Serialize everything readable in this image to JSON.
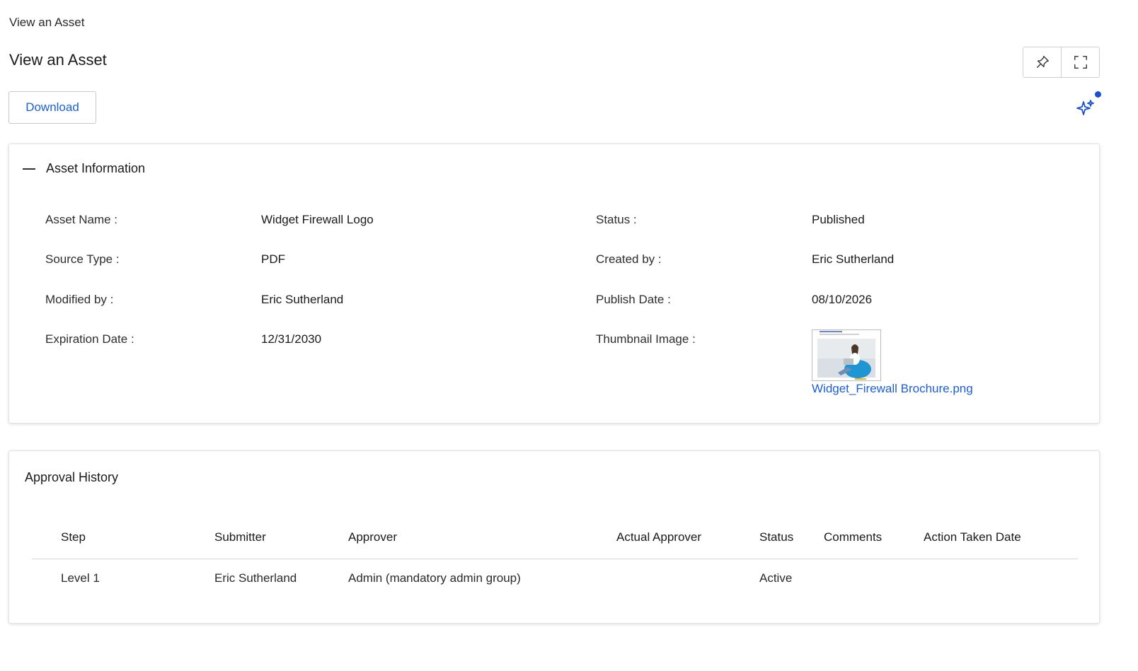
{
  "breadcrumb": "View an Asset",
  "page_title": "View an Asset",
  "toolbar": {
    "download_label": "Download",
    "pin_icon": "pin-icon",
    "fullscreen_icon": "expand-icon",
    "assistant_icon": "sparkle-icon"
  },
  "colors": {
    "link": "#1b5fd6",
    "notification": "#1b4fd0"
  },
  "asset_info": {
    "title": "Asset Information",
    "fields": {
      "asset_name": {
        "label": "Asset Name :",
        "value": "Widget Firewall Logo"
      },
      "status": {
        "label": "Status :",
        "value": "Published"
      },
      "source_type": {
        "label": "Source Type :",
        "value": "PDF"
      },
      "created_by": {
        "label": "Created by :",
        "value": "Eric Sutherland"
      },
      "modified_by": {
        "label": "Modified by :",
        "value": "Eric Sutherland"
      },
      "publish_date": {
        "label": "Publish Date :",
        "value": "08/10/2026"
      },
      "expiration_date": {
        "label": "Expiration Date :",
        "value": "12/31/2030"
      },
      "thumbnail": {
        "label": "Thumbnail Image :",
        "link": "Widget_Firewall Brochure.png"
      }
    }
  },
  "approval_history": {
    "title": "Approval History",
    "columns": [
      "Step",
      "Submitter",
      "Approver",
      "Actual Approver",
      "Status",
      "Comments",
      "Action Taken Date"
    ],
    "rows": [
      [
        "Level 1",
        "Eric Sutherland",
        "Admin (mandatory admin group)",
        "",
        "Active",
        "",
        ""
      ]
    ]
  }
}
